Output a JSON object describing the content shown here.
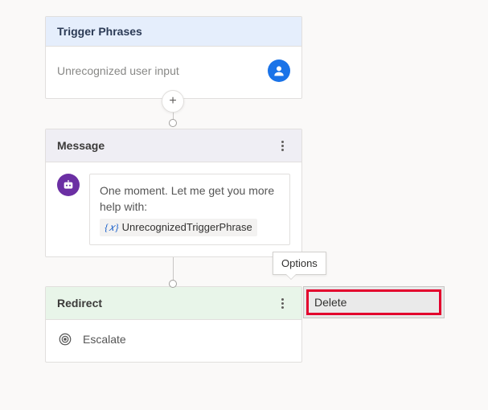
{
  "trigger": {
    "header": "Trigger Phrases",
    "value": "Unrecognized user input"
  },
  "message": {
    "header": "Message",
    "line1": "One moment. Let me get you more help with:",
    "variable": "UnrecognizedTriggerPhrase",
    "fx_label": "{𝑥}"
  },
  "redirect": {
    "header": "Redirect",
    "target": "Escalate"
  },
  "tooltip": {
    "text": "Options"
  },
  "menu": {
    "items": [
      {
        "label": "Delete"
      }
    ]
  },
  "plus_glyph": "+"
}
